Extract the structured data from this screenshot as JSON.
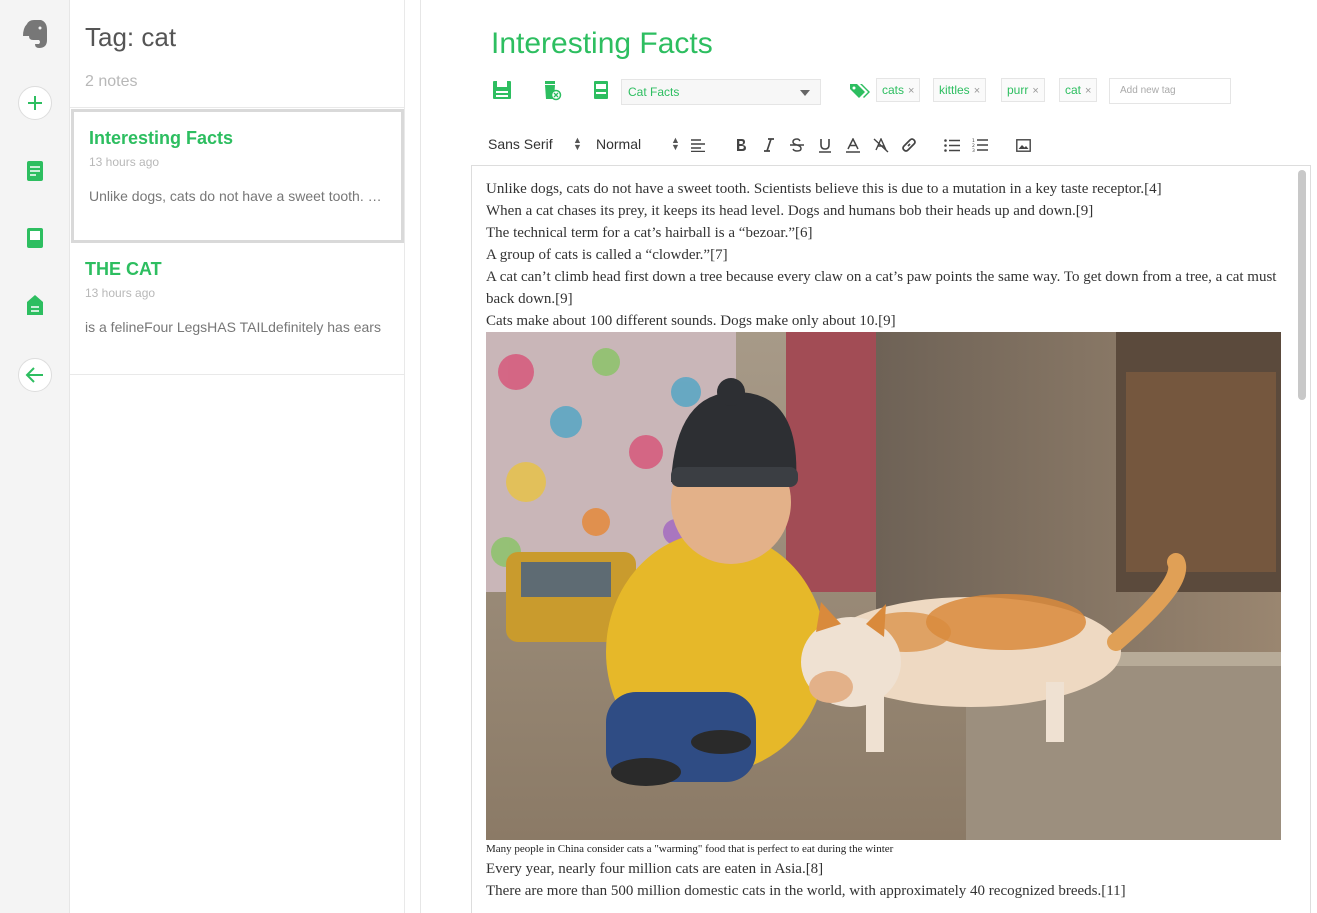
{
  "rail": {
    "icons": [
      "elephant-logo-icon",
      "new-note-icon",
      "notes-icon",
      "notebooks-icon",
      "tags-icon",
      "back-arrow-icon"
    ]
  },
  "list": {
    "title": "Tag: cat",
    "count": "2 notes",
    "notes": [
      {
        "title": "Interesting Facts",
        "time": "13 hours ago",
        "snippet": "Unlike dogs, cats do not have a sweet tooth. Scientists believe this is due to a mutation in a key taste receptor."
      },
      {
        "title": "THE CAT",
        "time": "13 hours ago",
        "snippet": "is a felineFour LegsHAS TAILdefinitely has ears"
      }
    ]
  },
  "editor": {
    "title": "Interesting Facts",
    "notebook": "Cat Facts",
    "tags": [
      "cats",
      "kittles",
      "purr",
      "cat"
    ],
    "tag_remove": "×",
    "add_tag_placeholder": "Add new tag",
    "font_family": "Sans Serif",
    "font_size": "Normal",
    "paragraphs_before": [
      "Unlike dogs, cats do not have a sweet tooth. Scientists believe this is due to a mutation in a key taste receptor.[4]",
      "When a cat chases its prey, it keeps its head level. Dogs and humans bob their heads up and down.[9]",
      "The technical term for a cat’s hairball is a “bezoar.”[6]",
      "A group of cats is called a “clowder.”[7]",
      "A cat can’t climb head first down a tree because every claw on a cat’s paw points the same way. To get down from a tree, a cat must back down.[9]",
      "Cats make about 100 different sounds. Dogs make only about 10.[9]"
    ],
    "caption": "Many people in China consider cats a \"warming\" food that is perfect to eat during the winter",
    "paragraphs_after": [
      "Every year, nearly four million cats are eaten in Asia.[8]",
      "There are more than 500 million domestic cats in the world, with approximately 40 recognized breeds.[11]"
    ]
  },
  "colors": {
    "accent": "#2dbe60",
    "rail_bg": "#f4f4f4",
    "muted": "#b8b8b8"
  }
}
